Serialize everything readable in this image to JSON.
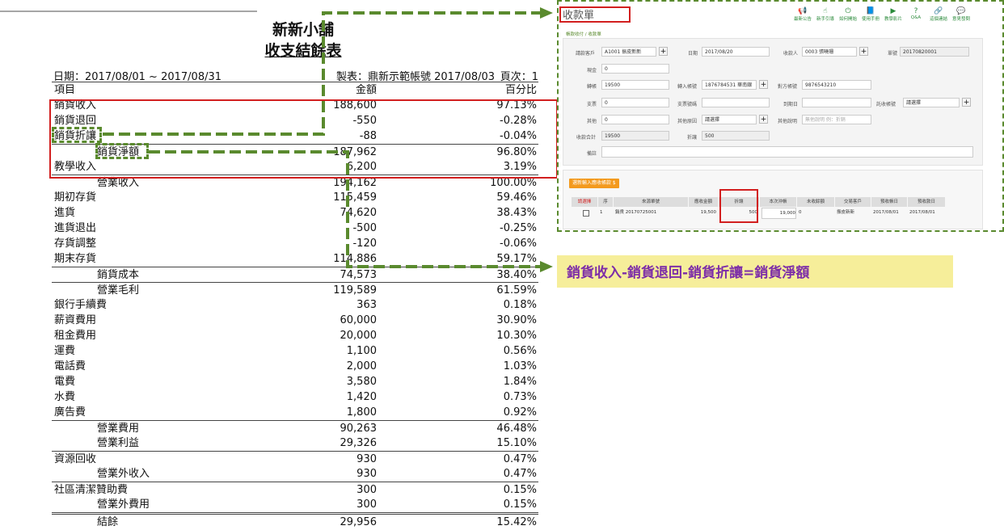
{
  "report": {
    "shop": "新新小舖",
    "title": "收支結餘表",
    "date_range": "日期：2017/08/01 ~ 2017/08/31",
    "maker": "製表：鼎新示範帳號 2017/08/03",
    "page": "頁次：1",
    "col_item": "項目",
    "col_amount": "金額",
    "col_pct": "百分比",
    "rows": [
      {
        "name": "銷貨收入",
        "amount": "188,600",
        "pct": "97.13%"
      },
      {
        "name": "銷貨退回",
        "amount": "-550",
        "pct": "-0.28%"
      },
      {
        "name": "銷貨折讓",
        "amount": "-88",
        "pct": "-0.04%"
      },
      {
        "name": "銷貨淨額",
        "amount": "187,962",
        "pct": "96.80%"
      },
      {
        "name": "教學收入",
        "amount": "6,200",
        "pct": "3.19%"
      },
      {
        "name": "營業收入",
        "amount": "194,162",
        "pct": "100.00%"
      },
      {
        "name": "期初存貨",
        "amount": "115,459",
        "pct": "59.46%"
      },
      {
        "name": "進貨",
        "amount": "74,620",
        "pct": "38.43%"
      },
      {
        "name": "進貨退出",
        "amount": "-500",
        "pct": "-0.25%"
      },
      {
        "name": "存貨調整",
        "amount": "-120",
        "pct": "-0.06%"
      },
      {
        "name": "期末存貨",
        "amount": "114,886",
        "pct": "59.17%"
      },
      {
        "name": "銷貨成本",
        "amount": "74,573",
        "pct": "38.40%"
      },
      {
        "name": "營業毛利",
        "amount": "119,589",
        "pct": "61.59%"
      },
      {
        "name": "銀行手續費",
        "amount": "363",
        "pct": "0.18%"
      },
      {
        "name": "薪資費用",
        "amount": "60,000",
        "pct": "30.90%"
      },
      {
        "name": "租金費用",
        "amount": "20,000",
        "pct": "10.30%"
      },
      {
        "name": "運費",
        "amount": "1,100",
        "pct": "0.56%"
      },
      {
        "name": "電話費",
        "amount": "2,000",
        "pct": "1.03%"
      },
      {
        "name": "電費",
        "amount": "3,580",
        "pct": "1.84%"
      },
      {
        "name": "水費",
        "amount": "1,420",
        "pct": "0.73%"
      },
      {
        "name": "廣告費",
        "amount": "1,800",
        "pct": "0.92%"
      },
      {
        "name": "營業費用",
        "amount": "90,263",
        "pct": "46.48%"
      },
      {
        "name": "營業利益",
        "amount": "29,326",
        "pct": "15.10%"
      },
      {
        "name": "資源回收",
        "amount": "930",
        "pct": "0.47%"
      },
      {
        "name": "營業外收入",
        "amount": "930",
        "pct": "0.47%"
      },
      {
        "name": "社區清潔贊助費",
        "amount": "300",
        "pct": "0.15%"
      },
      {
        "name": "營業外費用",
        "amount": "300",
        "pct": "0.15%"
      },
      {
        "name": "結餘",
        "amount": "29,956",
        "pct": "15.42%"
      }
    ]
  },
  "formula": "銷貨收入-銷貨退回-銷貨折讓=銷貨淨額",
  "form": {
    "title": "收款單",
    "breadcrumb": "帳款收付 / 收款單",
    "toolbar": [
      "最新公告",
      "新手引導",
      "如何開始",
      "使用手冊",
      "教學影片",
      "Q&A",
      "這個連結",
      "意見發問"
    ],
    "labels": {
      "customer": "請款客戶",
      "date": "日期",
      "payee": "收款人",
      "doc_no": "單號",
      "cash": "現金",
      "transfer": "轉帳",
      "in_account": "轉入帳號",
      "to_account": "對方帳號",
      "check": "支票",
      "check_no": "支票號碼",
      "due": "到期日",
      "collect_account": "託收帳號",
      "other": "其他",
      "other_reason": "其他原因",
      "other_note": "其他說明",
      "total": "收款合計",
      "discount": "折讓",
      "remark": "備註"
    },
    "values": {
      "customer": "A1001 振皮新新",
      "date": "2017/08/20",
      "payee": "0003 張曉珊",
      "doc_no": "20170820001",
      "cash": "0",
      "transfer": "19500",
      "in_account": "1876784531 華南銀",
      "to_account": "9876543210",
      "check": "0",
      "check_no": "",
      "due": "",
      "collect_account": "請選擇",
      "other": "0",
      "other_reason": "請選擇",
      "other_note": "無他說明 例：折銷",
      "total": "19500",
      "discount": "500",
      "remark": ""
    },
    "pick_button": "選新輸入應收帳款 $",
    "table_headers": [
      "請選擇",
      "序",
      "來源單號",
      "應收金額",
      "折讓",
      "本次沖帳",
      "未收餘額",
      "交易客戶",
      "預收帳日",
      "預收款日"
    ],
    "table_row": [
      "",
      "1",
      "銷貨 20170725001",
      "19,500",
      "500",
      "19,000",
      "0",
      "振皮新新",
      "2017/08/01",
      "2017/08/01"
    ]
  }
}
